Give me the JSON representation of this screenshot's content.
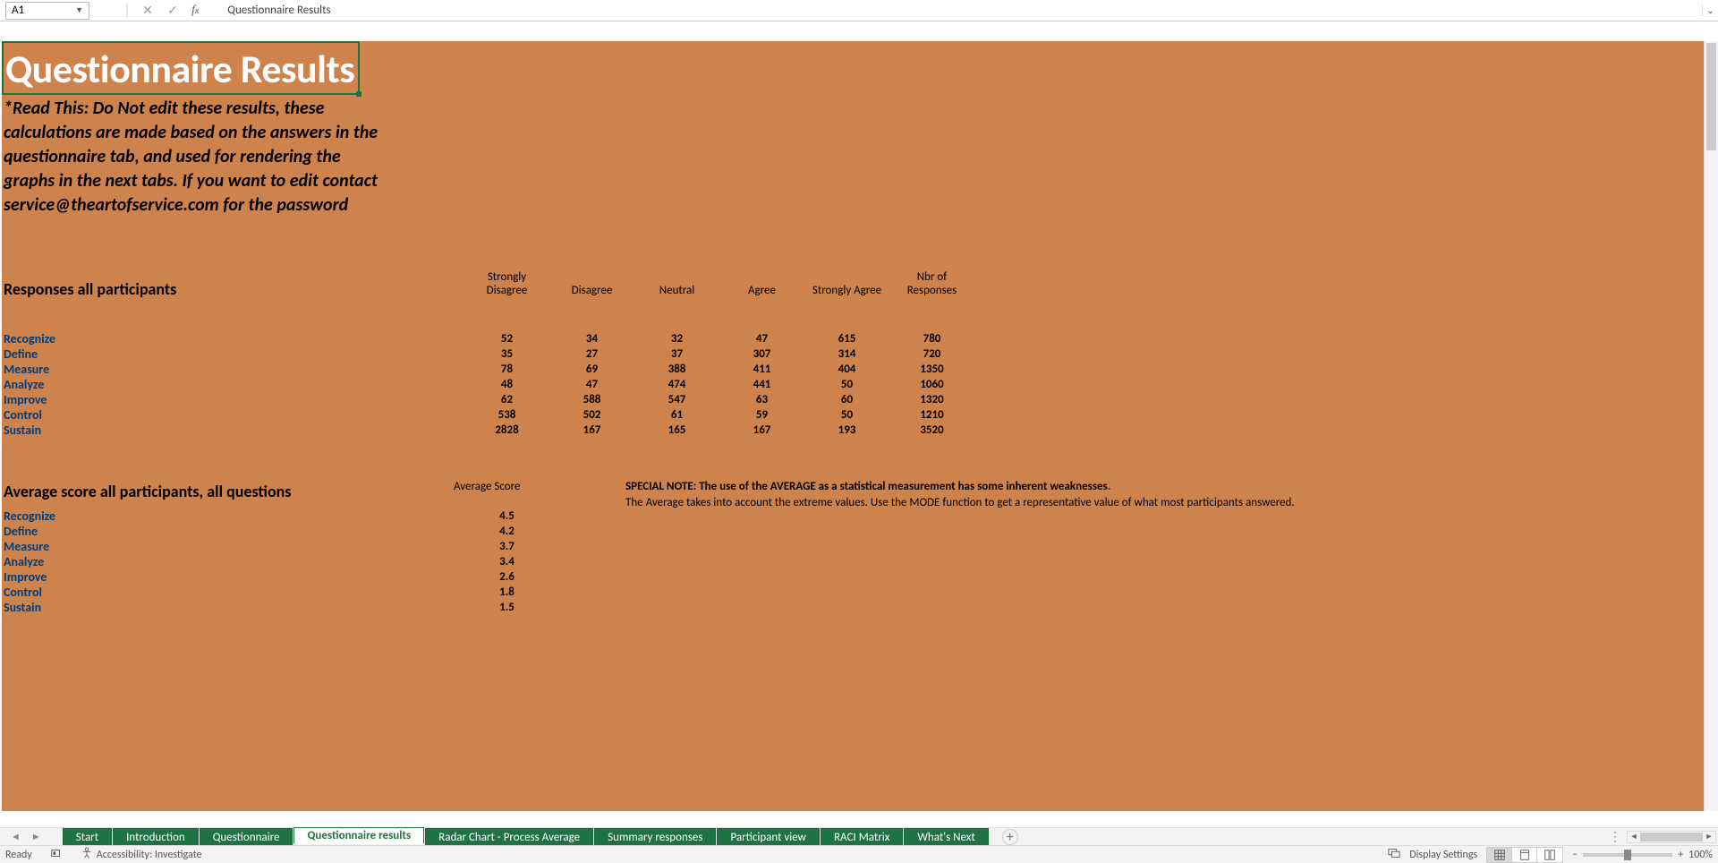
{
  "formula_bar": {
    "namebox": "A1",
    "formula_text": "Questionnaire Results"
  },
  "sheet": {
    "title": "Questionnaire Results",
    "readthis": "*Read This: Do Not edit these results, these calculations are made based on the answers in the questionnaire tab, and used for rendering the graphs in the next tabs. If you want to edit contact service@theartofservice.com for the password",
    "section1_heading": "Responses all participants",
    "section2_heading": "Average score all participants, all questions",
    "avg_score_label": "Average Score",
    "note_bold": "SPECIAL NOTE: The use of the AVERAGE as a statistical measurement has some inherent weaknesses.",
    "note_sub": "The Average takes into account the extreme values. Use the MODE function to get a representative value of what most participants answered."
  },
  "chart_data": {
    "type": "table",
    "responses": {
      "columns": [
        "Strongly Disagree",
        "Disagree",
        "Neutral",
        "Agree",
        "Strongly Agree",
        "Nbr of Responses"
      ],
      "rows": [
        {
          "label": "Recognize",
          "values": [
            52,
            34,
            32,
            47,
            615,
            780
          ]
        },
        {
          "label": "Define",
          "values": [
            35,
            27,
            37,
            307,
            314,
            720
          ]
        },
        {
          "label": "Measure",
          "values": [
            78,
            69,
            388,
            411,
            404,
            1350
          ]
        },
        {
          "label": "Analyze",
          "values": [
            48,
            47,
            474,
            441,
            50,
            1060
          ]
        },
        {
          "label": "Improve",
          "values": [
            62,
            588,
            547,
            63,
            60,
            1320
          ]
        },
        {
          "label": "Control",
          "values": [
            538,
            502,
            61,
            59,
            50,
            1210
          ]
        },
        {
          "label": "Sustain",
          "values": [
            2828,
            167,
            165,
            167,
            193,
            3520
          ]
        }
      ]
    },
    "averages": {
      "rows": [
        {
          "label": "Recognize",
          "value": 4.5
        },
        {
          "label": "Define",
          "value": 4.2
        },
        {
          "label": "Measure",
          "value": 3.7
        },
        {
          "label": "Analyze",
          "value": 3.4
        },
        {
          "label": "Improve",
          "value": 2.6
        },
        {
          "label": "Control",
          "value": 1.8
        },
        {
          "label": "Sustain",
          "value": 1.5
        }
      ]
    }
  },
  "tabs": {
    "items": [
      "Start",
      "Introduction",
      "Questionnaire",
      "Questionnaire results",
      "Radar Chart - Process Average",
      "Summary responses",
      "Participant view",
      "RACI Matrix",
      "What's Next"
    ],
    "active_index": 3
  },
  "status": {
    "ready": "Ready",
    "accessibility": "Accessibility: Investigate",
    "display_settings": "Display Settings",
    "zoom": "100%"
  }
}
